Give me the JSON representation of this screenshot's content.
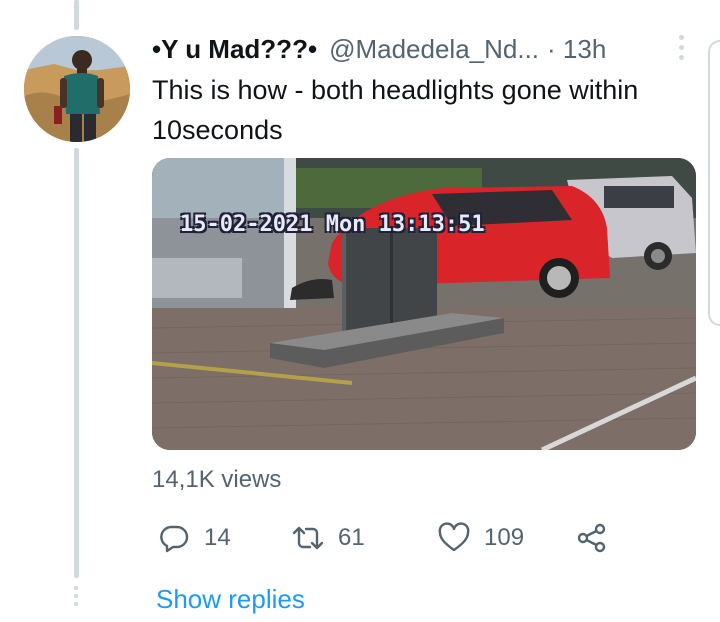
{
  "tweet": {
    "display_name": "•Y u Mad???•",
    "handle": "@Madedela_Nd...",
    "timestamp": "· 13h",
    "text": "This is how - both headlights gone within 10seconds",
    "media": {
      "overlay_text": "15-02-2021 Mon 13:13:51"
    },
    "views": "14,1K views",
    "actions": {
      "reply_count": "14",
      "retweet_count": "61",
      "like_count": "109"
    },
    "show_replies": "Show replies"
  },
  "icons": {
    "reply": "reply-icon",
    "retweet": "retweet-icon",
    "like": "heart-icon",
    "share": "share-icon",
    "more": "more-icon"
  },
  "colors": {
    "link_blue": "#1d9bf0",
    "secondary_text": "#536471",
    "thread_line": "#cfd9de"
  }
}
